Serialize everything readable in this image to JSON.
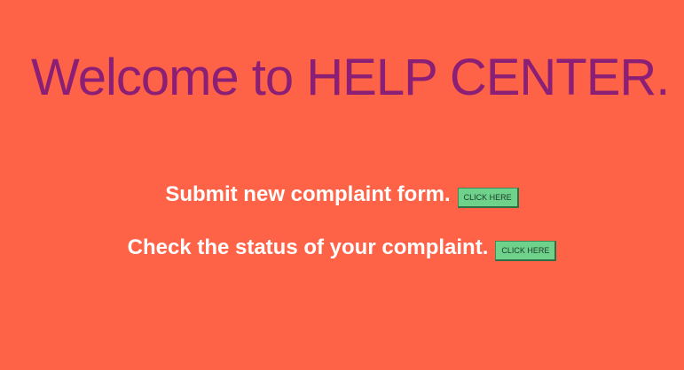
{
  "header": {
    "title": "Welcome to HELP CENTER."
  },
  "actions": {
    "submit": {
      "text": "Submit new complaint form.",
      "button_label": "CLICK HERE"
    },
    "status": {
      "text": "Check the status of your complaint.",
      "button_label": "CLICK HERE"
    }
  },
  "colors": {
    "background": "#ff6347",
    "title": "#8b1f75",
    "button": "#6ed28a",
    "text": "#ffffff"
  }
}
